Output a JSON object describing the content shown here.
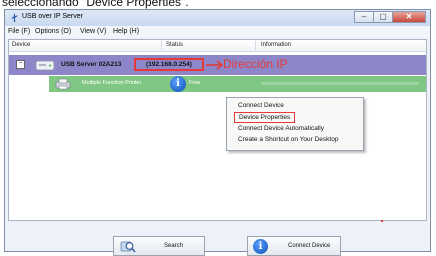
{
  "caption": "seleccionando \"Device Properties\".",
  "window": {
    "title": "USB over IP Server",
    "controls": [
      "–",
      "▢",
      "✕"
    ]
  },
  "menu": [
    "File (F)",
    "Options (O)",
    "View (V)",
    "Help (H)"
  ],
  "columns": [
    "Device",
    "Status",
    "Information"
  ],
  "server": {
    "expander": "−",
    "name": "USB Server 02A213",
    "ip": "(192.168.0.254)",
    "annotation": "Dirección IP"
  },
  "device": {
    "name": "Multiple Function Printer",
    "status": "Free"
  },
  "context_menu": {
    "items": [
      "Connect Device",
      "Device Properties",
      "Connect Device Automatically",
      "Create a Shortcut on Your Desktop"
    ],
    "highlighted": "Device Properties"
  },
  "buttons": {
    "search": "Search",
    "connect": "Connect Device"
  },
  "colors": {
    "server_row": "#8d87c9",
    "device_row": "#81c784",
    "annotation": "#e53935"
  }
}
